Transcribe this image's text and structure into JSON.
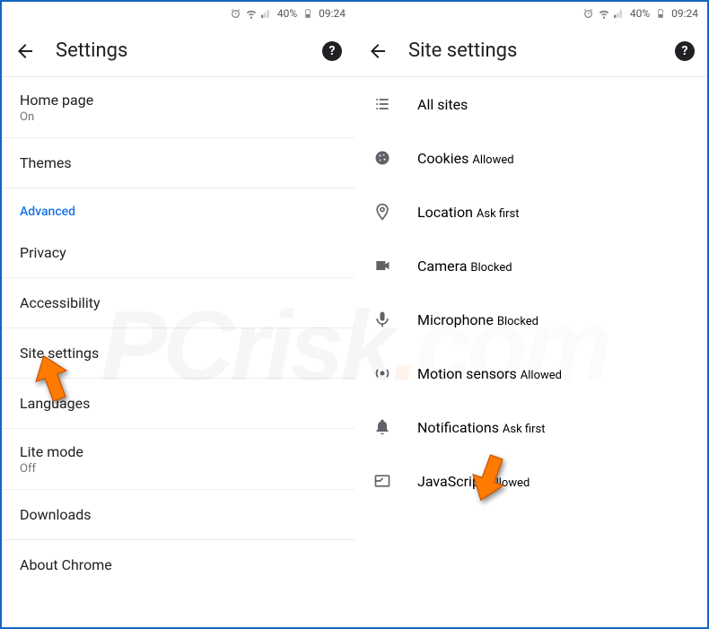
{
  "status": {
    "battery_pct": "40%",
    "time": "09:24"
  },
  "left": {
    "title": "Settings",
    "items": [
      {
        "label": "Home page",
        "sub": "On"
      },
      {
        "label": "Themes"
      },
      {
        "section": "Advanced"
      },
      {
        "label": "Privacy"
      },
      {
        "label": "Accessibility"
      },
      {
        "label": "Site settings"
      },
      {
        "label": "Languages"
      },
      {
        "label": "Lite mode",
        "sub": "Off"
      },
      {
        "label": "Downloads"
      },
      {
        "label": "About Chrome"
      }
    ]
  },
  "right": {
    "title": "Site settings",
    "items": [
      {
        "icon": "list",
        "label": "All sites"
      },
      {
        "icon": "cookie",
        "label": "Cookies",
        "sub": "Allowed"
      },
      {
        "icon": "location",
        "label": "Location",
        "sub": "Ask first"
      },
      {
        "icon": "camera",
        "label": "Camera",
        "sub": "Blocked"
      },
      {
        "icon": "mic",
        "label": "Microphone",
        "sub": "Blocked"
      },
      {
        "icon": "motion",
        "label": "Motion sensors",
        "sub": "Allowed"
      },
      {
        "icon": "bell",
        "label": "Notifications",
        "sub": "Ask first"
      },
      {
        "icon": "js",
        "label": "JavaScript",
        "sub": "Allowed"
      }
    ]
  },
  "help_glyph": "?"
}
